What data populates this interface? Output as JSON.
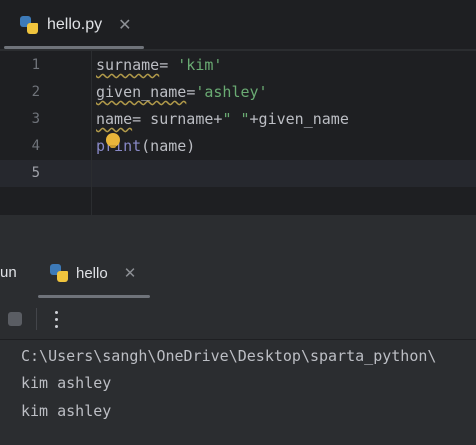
{
  "editor": {
    "tab": {
      "label": "hello.py",
      "close_glyph": "✕"
    },
    "line_numbers": [
      "1",
      "2",
      "3",
      "4",
      "5"
    ],
    "current_line": "5",
    "code": {
      "l1": {
        "var": "surname",
        "eq": "= ",
        "str": "'kim'"
      },
      "l2": {
        "var": "given_name",
        "eq": "=",
        "str": "'ashley'"
      },
      "l3": {
        "var": "name",
        "eq": "= surname+",
        "str": "\" \"",
        "rest": "+given_name"
      },
      "l4": {
        "fn": "print",
        "rest": "(name)"
      }
    }
  },
  "run": {
    "title": "un",
    "tab": {
      "label": "hello",
      "close_glyph": "✕"
    },
    "more_glyph": "⋮"
  },
  "console": {
    "lines": [
      "C:\\Users\\sangh\\OneDrive\\Desktop\\sparta_python\\",
      "kim ashley",
      "kim ashley"
    ]
  },
  "colors": {
    "editor_bg": "#1e1f22",
    "panel_bg": "#2b2d30",
    "string": "#6aab73",
    "builtin": "#8888c6",
    "bulb": "#e9b53a"
  }
}
